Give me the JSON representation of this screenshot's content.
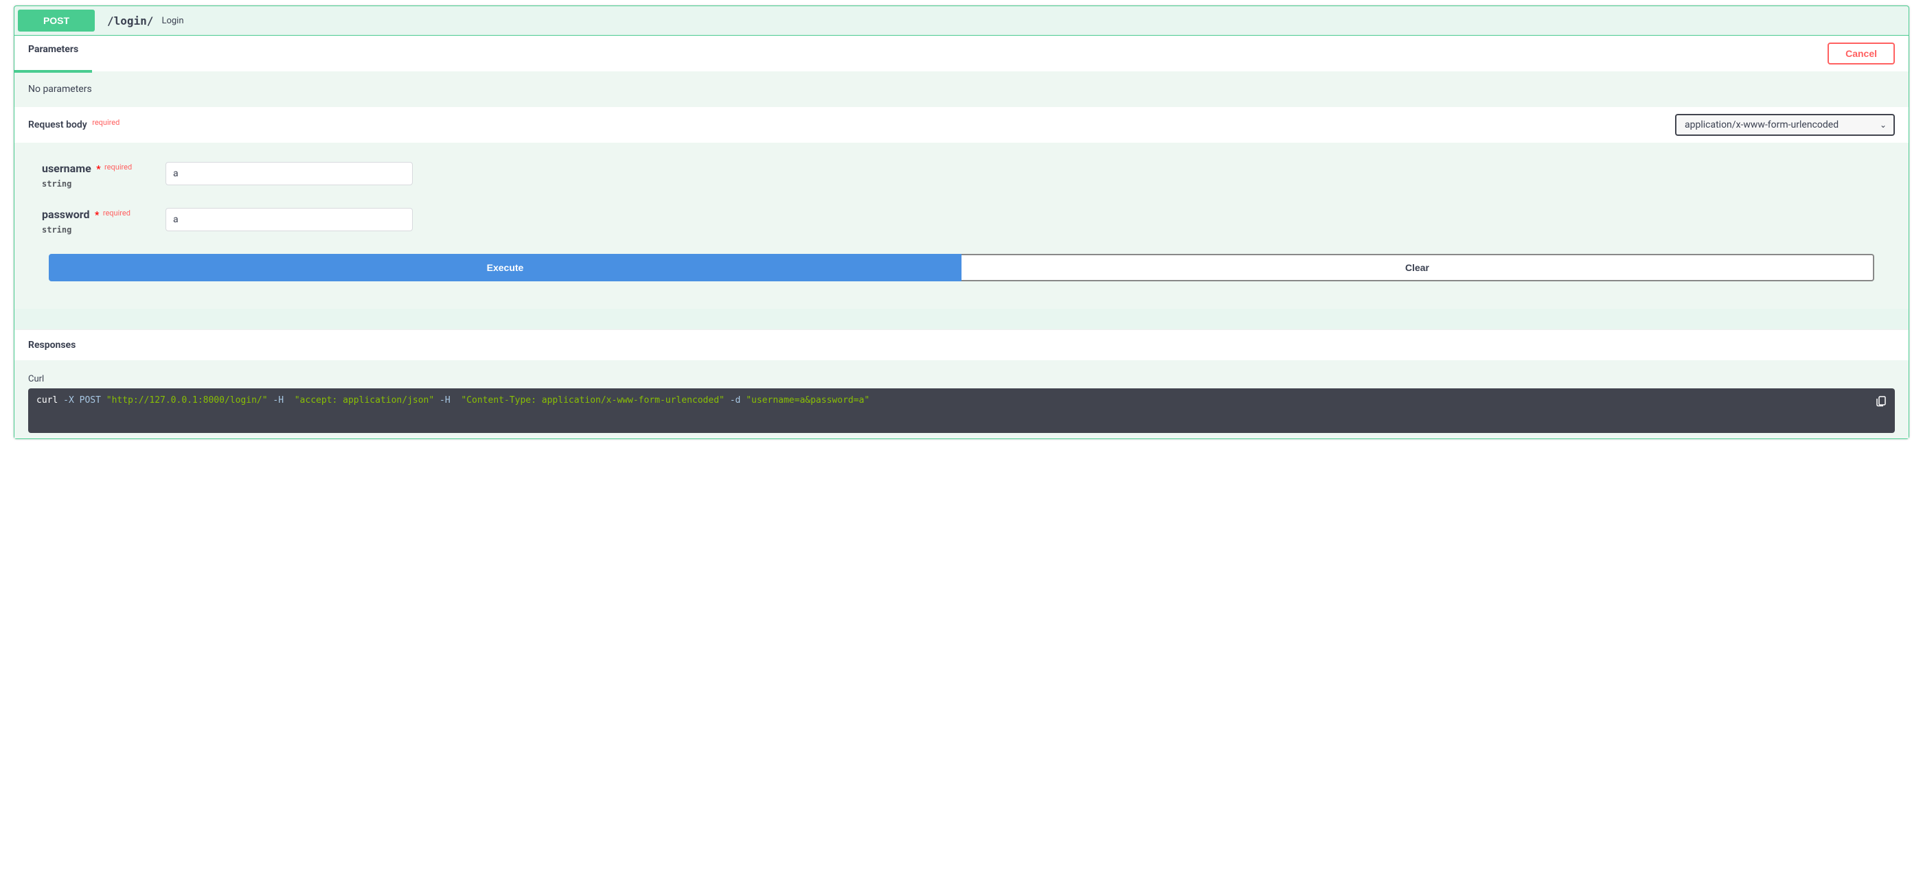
{
  "operation": {
    "method": "POST",
    "path": "/login/",
    "summary": "Login"
  },
  "tabs": {
    "parameters_label": "Parameters"
  },
  "buttons": {
    "cancel": "Cancel",
    "execute": "Execute",
    "clear": "Clear"
  },
  "parameters": {
    "empty_message": "No parameters"
  },
  "request_body": {
    "title": "Request body",
    "required_label": "required",
    "content_type_selected": "application/x-www-form-urlencoded",
    "fields": {
      "username": {
        "name": "username",
        "required_label": "required",
        "type": "string",
        "value": "a"
      },
      "password": {
        "name": "password",
        "required_label": "required",
        "type": "string",
        "value": "a"
      }
    }
  },
  "responses": {
    "title": "Responses",
    "curl_label": "Curl",
    "curl": {
      "cmd": "curl",
      "method_flag": "-X POST",
      "url": "\"http://127.0.0.1:8000/login/\"",
      "h_flag": "-H",
      "accept_header": "\"accept: application/json\"",
      "ct_header": "\"Content-Type: application/x-www-form-urlencoded\"",
      "d_flag": "-d",
      "data": "\"username=a&password=a\""
    }
  }
}
